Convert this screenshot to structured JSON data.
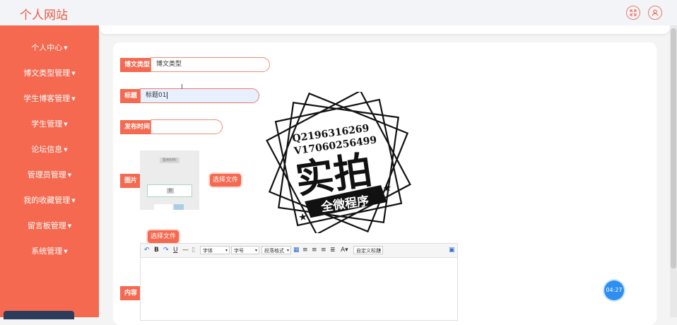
{
  "header": {
    "site_title": "个人网站"
  },
  "sidebar": {
    "items": [
      {
        "label": "个人中心"
      },
      {
        "label": "博文类型管理"
      },
      {
        "label": "学生博客管理"
      },
      {
        "label": "学生管理"
      },
      {
        "label": "论坛信息"
      },
      {
        "label": "管理员管理"
      },
      {
        "label": "我的收藏管理"
      },
      {
        "label": "留言板管理"
      },
      {
        "label": "系统管理"
      }
    ]
  },
  "form": {
    "type_label": "博文类型",
    "type_value": "博文类型",
    "title_label": "标题",
    "title_value": "标题01",
    "time_label": "发布时间",
    "time_value": "",
    "image_label": "图片",
    "image_choose": "选择文件",
    "content_choose": "选择文件",
    "content_label": "内容"
  },
  "image_preview": {
    "top_text": "勤用材料",
    "middle_text": "删"
  },
  "editor": {
    "font": "字体",
    "size": "字号",
    "paragraph": "段落格式",
    "custom_title": "自定义标题"
  },
  "watermark": {
    "line1": "Q2196316269",
    "line2": "V17060256499",
    "big": "实拍",
    "banner": "全微程序"
  },
  "timer": {
    "value": "04:27"
  },
  "colors": {
    "accent": "#f4694f",
    "title": "#ec5a44",
    "timer": "#2d8ff0"
  }
}
